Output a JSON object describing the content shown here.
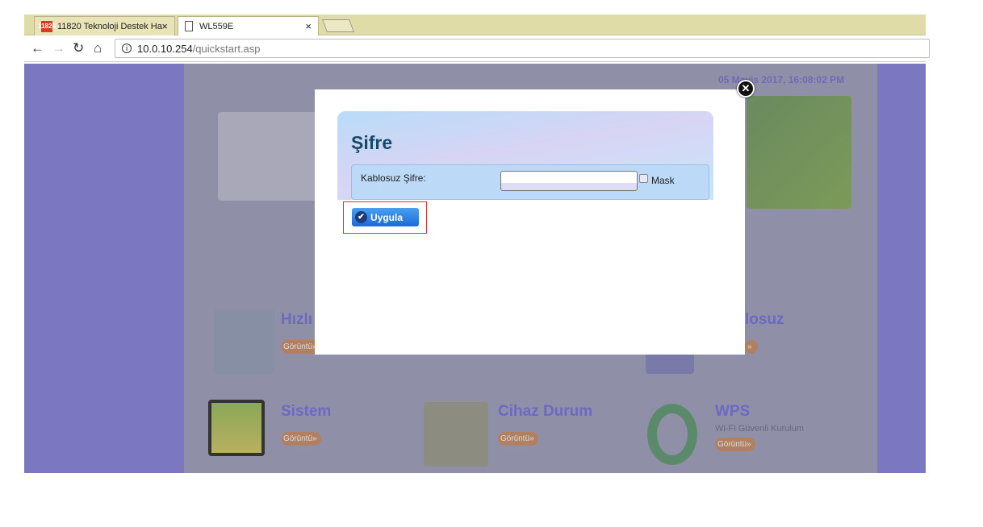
{
  "browser": {
    "tabs": [
      {
        "label": "11820 Teknoloji Destek Ha",
        "favicon": "11820"
      },
      {
        "label": "WL559E"
      }
    ],
    "close_glyph": "×",
    "url_host": "10.0.10.254",
    "url_path": "/quickstart.asp"
  },
  "page": {
    "datetime": "05 Mayis 2017, 16:08:02 PM",
    "tiles": [
      {
        "title": "Hızlı",
        "button": "Görüntü»"
      },
      {
        "title": "losuz",
        "button": "»"
      },
      {
        "title": "Sistem",
        "button": "Görüntü»"
      },
      {
        "title": "Cihaz Durum",
        "button": "Görüntü»"
      },
      {
        "title": "WPS",
        "subtitle": "Wi-Fi Güvenli Kurulum",
        "button": "Görüntü»"
      }
    ]
  },
  "modal": {
    "title": "Şifre",
    "field_label": "Kablosuz Şifre:",
    "password_value": "",
    "mask_label": "Mask",
    "mask_checked": false,
    "apply_label": "Uygula",
    "close_glyph": "✕"
  }
}
